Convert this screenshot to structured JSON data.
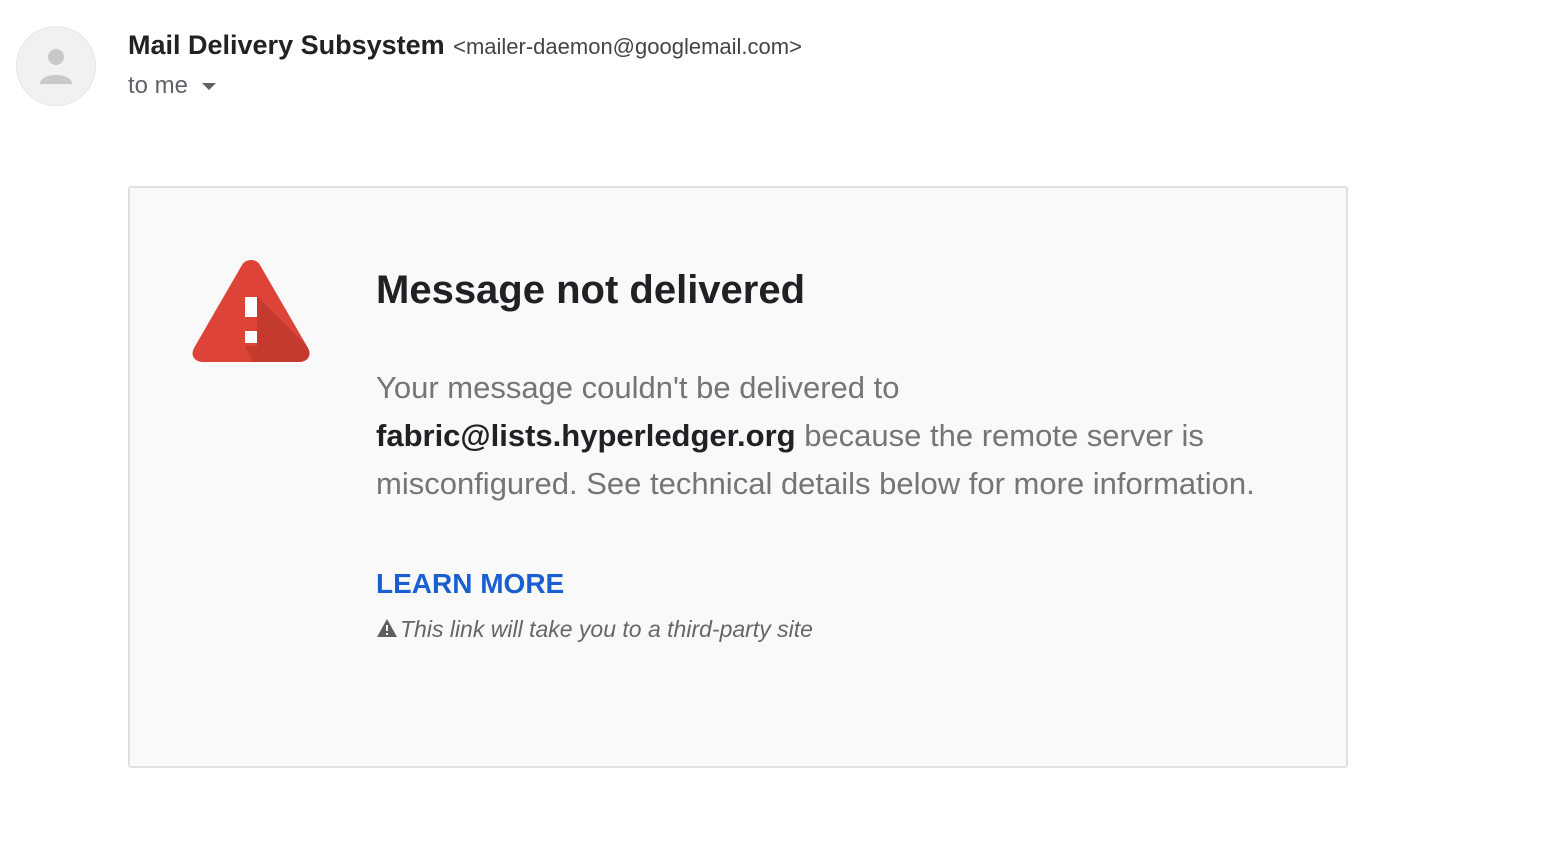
{
  "header": {
    "sender_name": "Mail Delivery Subsystem",
    "sender_email": "<mailer-daemon@googlemail.com>",
    "recipient_label": "to me",
    "avatar_icon": "person-icon",
    "recipient_toggle_icon": "caret-down-icon"
  },
  "card": {
    "icon": "warning-icon",
    "title": "Message not delivered",
    "body_prefix": "Your message couldn't be delivered to ",
    "recipient_address": "fabric@lists.hyperledger.org",
    "body_suffix": " because the remote server is misconfigured. See technical details below for more information.",
    "learn_more_label": "LEARN MORE",
    "third_party_note": "This link will take you to a third-party site",
    "note_icon": "small-warning-icon"
  },
  "colors": {
    "warning_red": "#de4337",
    "warning_red_shadow": "#c0382d",
    "link_blue": "#1a5fd1",
    "card_background": "#f9f9f9",
    "card_border": "#e0e0e0"
  }
}
